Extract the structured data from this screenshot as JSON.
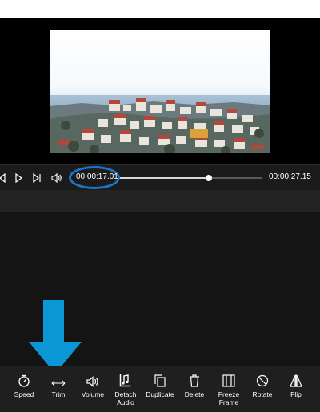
{
  "transport": {
    "current_time": "00:00:17.01",
    "total_time": "00:00:27.15",
    "progress": 0.626,
    "icons": [
      "skip-back-icon",
      "play-icon",
      "skip-forward-icon",
      "volume-icon"
    ]
  },
  "toolbar": {
    "items": [
      {
        "label": "Speed",
        "icon": "speedometer-icon"
      },
      {
        "label": "Trim",
        "icon": "trim-arrows-icon"
      },
      {
        "label": "Volume",
        "icon": "volume-icon"
      },
      {
        "label": "Detach\nAudio",
        "icon": "detach-audio-icon"
      },
      {
        "label": "Duplicate",
        "icon": "duplicate-icon"
      },
      {
        "label": "Delete",
        "icon": "trash-icon"
      },
      {
        "label": "Freeze\nFrame",
        "icon": "freeze-frame-icon"
      },
      {
        "label": "Rotate",
        "icon": "rotate-icon"
      },
      {
        "label": "Flip",
        "icon": "flip-icon"
      }
    ]
  },
  "colors": {
    "highlight_ring": "#1e73c4",
    "arrow": "#0b97d6",
    "toolbar_bg": "#1f1f1f"
  }
}
